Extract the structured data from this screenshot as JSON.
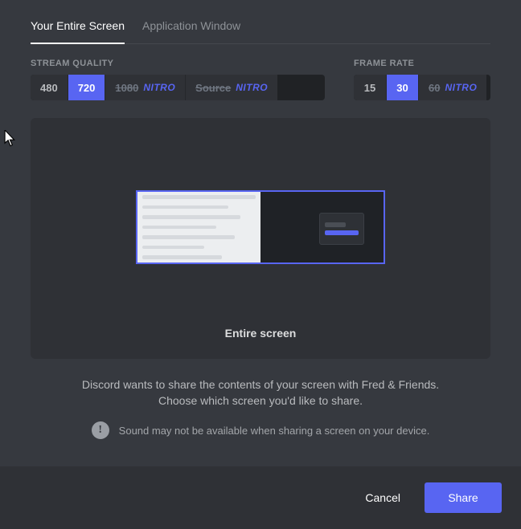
{
  "tabs": {
    "entire_screen": "Your Entire Screen",
    "app_window": "Application Window"
  },
  "quality": {
    "label": "Stream Quality",
    "o480": "480",
    "o720": "720",
    "o1080": "1080",
    "osource": "Source",
    "nitro": "NITRO"
  },
  "framerate": {
    "label": "Frame Rate",
    "o15": "15",
    "o30": "30",
    "o60": "60",
    "nitro": "NITRO"
  },
  "preview": {
    "caption": "Entire screen"
  },
  "description": {
    "line1": "Discord wants to share the contents of your screen with Fred & Friends.",
    "line2": "Choose which screen you'd like to share."
  },
  "warning": {
    "glyph": "!",
    "text": "Sound may not be available when sharing a screen on your device."
  },
  "footer": {
    "cancel": "Cancel",
    "share": "Share"
  }
}
